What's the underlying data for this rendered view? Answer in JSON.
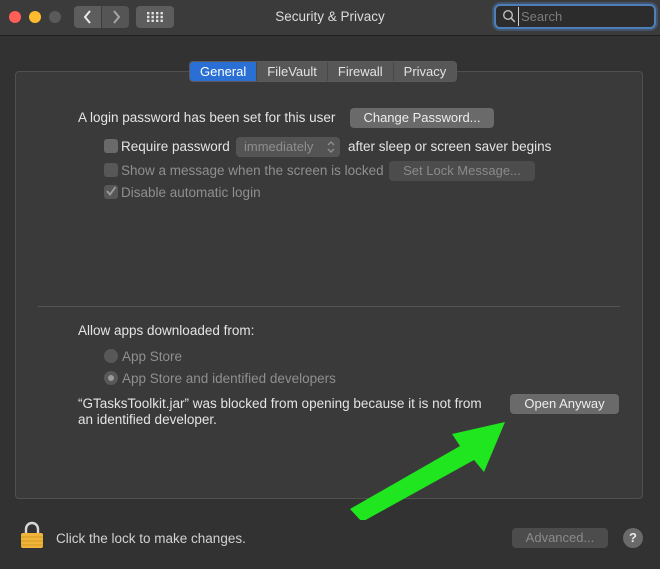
{
  "window": {
    "title": "Security & Privacy",
    "search_placeholder": "Search"
  },
  "tabs": [
    {
      "label": "General",
      "active": true
    },
    {
      "label": "FileVault",
      "active": false
    },
    {
      "label": "Firewall",
      "active": false
    },
    {
      "label": "Privacy",
      "active": false
    }
  ],
  "general": {
    "login_text": "A login password has been set for this user",
    "change_password_label": "Change Password...",
    "require_password": {
      "label": "Require password",
      "checked": false
    },
    "require_delay_value": "immediately",
    "require_suffix": "after sleep or screen saver begins",
    "show_message": {
      "label": "Show a message when the screen is locked",
      "checked": false,
      "enabled": false
    },
    "set_lock_message_label": "Set Lock Message...",
    "disable_autologin": {
      "label": "Disable automatic login",
      "checked": true,
      "enabled": false
    }
  },
  "allow_apps": {
    "heading": "Allow apps downloaded from:",
    "options": [
      {
        "label": "App Store",
        "selected": false
      },
      {
        "label": "App Store and identified developers",
        "selected": true
      }
    ],
    "blocked_line1": "“GTasksToolkit.jar” was blocked from opening because it is not from",
    "blocked_line2": "an identified developer.",
    "open_anyway_label": "Open Anyway"
  },
  "footer": {
    "lock_text": "Click the lock to make changes.",
    "advanced_label": "Advanced...",
    "help_label": "?"
  },
  "colors": {
    "accent_tab": "#2a6fd4",
    "annotation_arrow": "#1fe61f"
  }
}
